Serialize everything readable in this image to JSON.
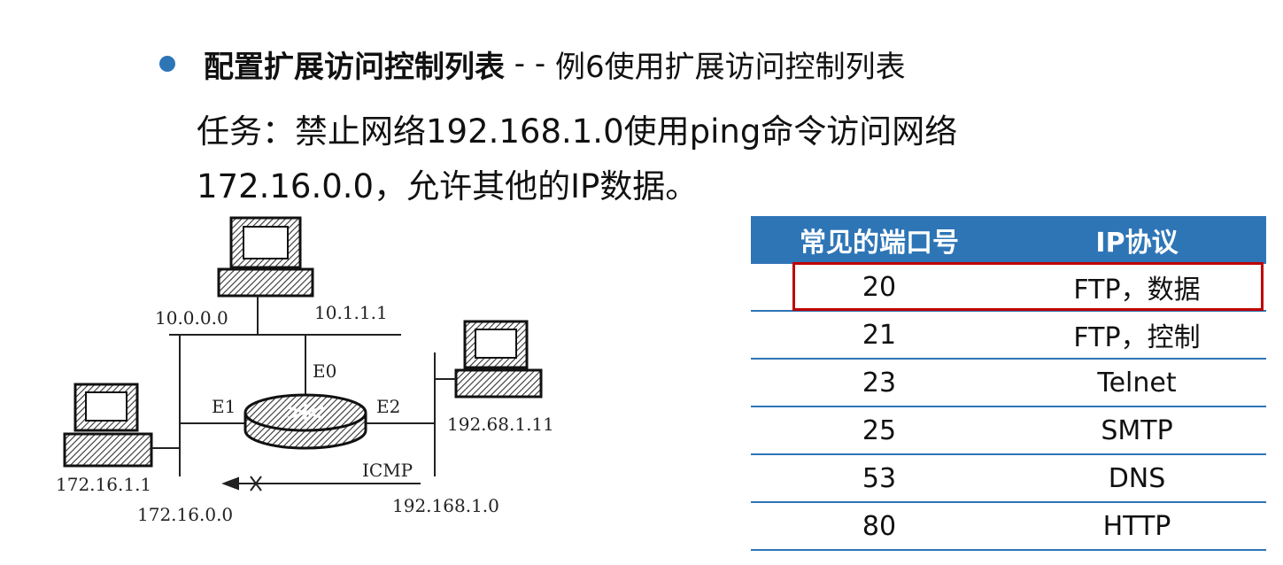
{
  "heading": {
    "bold_title": "配置扩展访问控制列表",
    "separator": " - - ",
    "subtitle": "例6使用扩展访问控制列表"
  },
  "task": {
    "line1": "任务：禁止网络192.168.1.0使用ping命令访问网络",
    "line2": "172.16.0.0，允许其他的IP数据。"
  },
  "diagram": {
    "labels": {
      "net_top_left": "10.0.0.0",
      "net_top_right": "10.1.1.1",
      "iface_e0": "E0",
      "iface_e1": "E1",
      "iface_e2": "E2",
      "host_right": "192.68.1.11",
      "host_left": "172.16.1.1",
      "net_bottom_left": "172.16.0.0",
      "net_bottom_right": "192.168.1.0",
      "protocol": "ICMP"
    }
  },
  "port_table": {
    "headers": {
      "port": "常见的端口号",
      "protocol": "IP协议"
    },
    "rows": [
      {
        "port": "20",
        "protocol": "FTP，数据"
      },
      {
        "port": "21",
        "protocol": "FTP，控制"
      },
      {
        "port": "23",
        "protocol": "Telnet"
      },
      {
        "port": "25",
        "protocol": "SMTP"
      },
      {
        "port": "53",
        "protocol": "DNS"
      },
      {
        "port": "80",
        "protocol": "HTTP"
      }
    ],
    "highlighted_row": 0
  },
  "colors": {
    "accent_blue": "#2e75b6",
    "highlight_red": "#c00000"
  }
}
